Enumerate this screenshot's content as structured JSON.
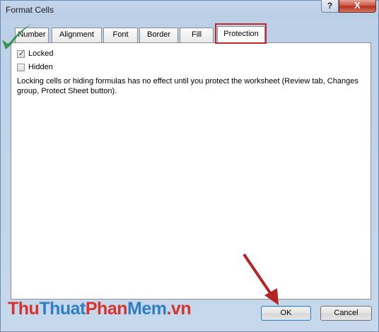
{
  "window": {
    "title": "Format Cells",
    "help_label": "?",
    "close_label": "X"
  },
  "tabs": [
    {
      "label": "Number"
    },
    {
      "label": "Alignment"
    },
    {
      "label": "Font"
    },
    {
      "label": "Border"
    },
    {
      "label": "Fill"
    },
    {
      "label": "Protection",
      "active": true
    }
  ],
  "protection": {
    "locked": {
      "label": "Locked",
      "checked": true
    },
    "hidden": {
      "label": "Hidden",
      "checked": false
    },
    "info": "Locking cells or hiding formulas has no effect until you protect the worksheet (Review tab, Changes group, Protect Sheet button)."
  },
  "buttons": {
    "ok_label": "OK",
    "cancel_label": "Cancel"
  },
  "watermark": {
    "part_red_1": "Thu",
    "part_blue_1": "Thuat",
    "part_red_2": "Phan",
    "part_blue_2": "Mem",
    "part_red_3": ".vn"
  },
  "colors": {
    "highlight_red": "#c0282e",
    "check_green": "#1e8a3c"
  }
}
